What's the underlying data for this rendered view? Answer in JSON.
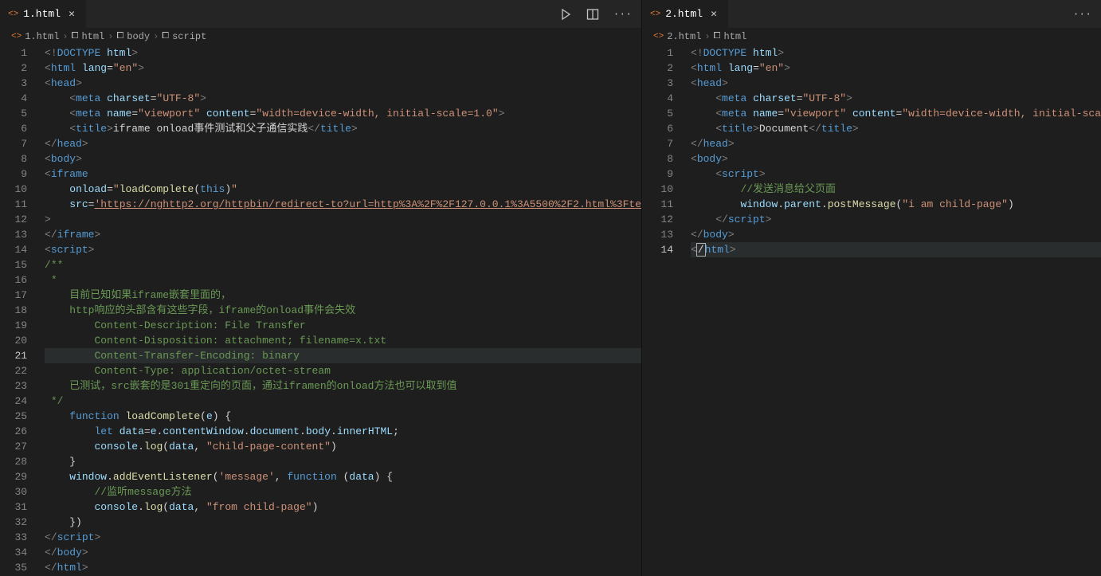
{
  "left": {
    "tab": {
      "filename": "1.html"
    },
    "breadcrumb": [
      "1.html",
      "html",
      "body",
      "script"
    ],
    "currentLine": 21,
    "lineCount": 35,
    "lines": [
      [
        {
          "c": "t-gray",
          "t": "<!"
        },
        {
          "c": "t-blue",
          "t": "DOCTYPE"
        },
        {
          "c": "t-white",
          "t": " "
        },
        {
          "c": "t-lblue",
          "t": "html"
        },
        {
          "c": "t-gray",
          "t": ">"
        }
      ],
      [
        {
          "c": "t-gray",
          "t": "<"
        },
        {
          "c": "t-blue",
          "t": "html"
        },
        {
          "c": "t-white",
          "t": " "
        },
        {
          "c": "t-lblue",
          "t": "lang"
        },
        {
          "c": "t-white",
          "t": "="
        },
        {
          "c": "t-str",
          "t": "\"en\""
        },
        {
          "c": "t-gray",
          "t": ">"
        }
      ],
      [
        {
          "c": "t-gray",
          "t": "<"
        },
        {
          "c": "t-blue",
          "t": "head"
        },
        {
          "c": "t-gray",
          "t": ">"
        }
      ],
      [
        {
          "c": "t-white",
          "t": "    "
        },
        {
          "c": "t-gray",
          "t": "<"
        },
        {
          "c": "t-blue",
          "t": "meta"
        },
        {
          "c": "t-white",
          "t": " "
        },
        {
          "c": "t-lblue",
          "t": "charset"
        },
        {
          "c": "t-white",
          "t": "="
        },
        {
          "c": "t-str",
          "t": "\"UTF-8\""
        },
        {
          "c": "t-gray",
          "t": ">"
        }
      ],
      [
        {
          "c": "t-white",
          "t": "    "
        },
        {
          "c": "t-gray",
          "t": "<"
        },
        {
          "c": "t-blue",
          "t": "meta"
        },
        {
          "c": "t-white",
          "t": " "
        },
        {
          "c": "t-lblue",
          "t": "name"
        },
        {
          "c": "t-white",
          "t": "="
        },
        {
          "c": "t-str",
          "t": "\"viewport\""
        },
        {
          "c": "t-white",
          "t": " "
        },
        {
          "c": "t-lblue",
          "t": "content"
        },
        {
          "c": "t-white",
          "t": "="
        },
        {
          "c": "t-str",
          "t": "\"width=device-width, initial-scale=1.0\""
        },
        {
          "c": "t-gray",
          "t": ">"
        }
      ],
      [
        {
          "c": "t-white",
          "t": "    "
        },
        {
          "c": "t-gray",
          "t": "<"
        },
        {
          "c": "t-blue",
          "t": "title"
        },
        {
          "c": "t-gray",
          "t": ">"
        },
        {
          "c": "t-white",
          "t": "iframe onload事件测试和父子通信实践"
        },
        {
          "c": "t-gray",
          "t": "</"
        },
        {
          "c": "t-blue",
          "t": "title"
        },
        {
          "c": "t-gray",
          "t": ">"
        }
      ],
      [
        {
          "c": "t-gray",
          "t": "</"
        },
        {
          "c": "t-blue",
          "t": "head"
        },
        {
          "c": "t-gray",
          "t": ">"
        }
      ],
      [
        {
          "c": "t-gray",
          "t": "<"
        },
        {
          "c": "t-blue",
          "t": "body"
        },
        {
          "c": "t-gray",
          "t": ">"
        }
      ],
      [
        {
          "c": "t-gray",
          "t": "<"
        },
        {
          "c": "t-blue",
          "t": "iframe"
        }
      ],
      [
        {
          "c": "t-white",
          "t": "    "
        },
        {
          "c": "t-lblue",
          "t": "onload"
        },
        {
          "c": "t-white",
          "t": "="
        },
        {
          "c": "t-str",
          "t": "\""
        },
        {
          "c": "t-yellow",
          "t": "loadComplete"
        },
        {
          "c": "t-white",
          "t": "("
        },
        {
          "c": "t-blue",
          "t": "this"
        },
        {
          "c": "t-white",
          "t": ")"
        },
        {
          "c": "t-str",
          "t": "\""
        }
      ],
      [
        {
          "c": "t-white",
          "t": "    "
        },
        {
          "c": "t-lblue",
          "t": "src"
        },
        {
          "c": "t-white",
          "t": "="
        },
        {
          "c": "t-str underline",
          "t": "'https://nghttp2.org/httpbin/redirect-to?url=http%3A%2F%2F127.0.0.1%3A5500%2F2.html%3Fte"
        }
      ],
      [
        {
          "c": "t-gray",
          "t": ">"
        }
      ],
      [
        {
          "c": "t-gray",
          "t": "</"
        },
        {
          "c": "t-blue",
          "t": "iframe"
        },
        {
          "c": "t-gray",
          "t": ">"
        }
      ],
      [
        {
          "c": "t-gray",
          "t": "<"
        },
        {
          "c": "t-blue",
          "t": "script"
        },
        {
          "c": "t-gray",
          "t": ">"
        }
      ],
      [
        {
          "c": "t-green",
          "t": "/**"
        }
      ],
      [
        {
          "c": "t-green",
          "t": " * "
        }
      ],
      [
        {
          "c": "t-green",
          "t": "    目前已知如果iframe嵌套里面的，"
        }
      ],
      [
        {
          "c": "t-green",
          "t": "    http响应的头部含有这些字段，iframe的onload事件会失效"
        }
      ],
      [
        {
          "c": "t-green",
          "t": "        Content-Description: File Transfer"
        }
      ],
      [
        {
          "c": "t-green",
          "t": "        Content-Disposition: attachment; filename=x.txt"
        }
      ],
      [
        {
          "c": "t-green",
          "t": "        Content-Transfer-Encoding: binary"
        }
      ],
      [
        {
          "c": "t-green",
          "t": "        Content-Type: application/octet-stream"
        }
      ],
      [
        {
          "c": "t-green",
          "t": "    已测试，src嵌套的是301重定向的页面，通过iframen的onload方法也可以取到值"
        }
      ],
      [
        {
          "c": "t-green",
          "t": " */"
        }
      ],
      [
        {
          "c": "t-white",
          "t": "    "
        },
        {
          "c": "t-blue",
          "t": "function"
        },
        {
          "c": "t-white",
          "t": " "
        },
        {
          "c": "t-yellow",
          "t": "loadComplete"
        },
        {
          "c": "t-white",
          "t": "("
        },
        {
          "c": "t-lblue",
          "t": "e"
        },
        {
          "c": "t-white",
          "t": ") {"
        }
      ],
      [
        {
          "c": "t-white",
          "t": "        "
        },
        {
          "c": "t-blue",
          "t": "let"
        },
        {
          "c": "t-white",
          "t": " "
        },
        {
          "c": "t-lblue",
          "t": "data"
        },
        {
          "c": "t-white",
          "t": "="
        },
        {
          "c": "t-lblue",
          "t": "e"
        },
        {
          "c": "t-white",
          "t": "."
        },
        {
          "c": "t-lblue",
          "t": "contentWindow"
        },
        {
          "c": "t-white",
          "t": "."
        },
        {
          "c": "t-lblue",
          "t": "document"
        },
        {
          "c": "t-white",
          "t": "."
        },
        {
          "c": "t-lblue",
          "t": "body"
        },
        {
          "c": "t-white",
          "t": "."
        },
        {
          "c": "t-lblue",
          "t": "innerHTML"
        },
        {
          "c": "t-white",
          "t": ";"
        }
      ],
      [
        {
          "c": "t-white",
          "t": "        "
        },
        {
          "c": "t-lblue",
          "t": "console"
        },
        {
          "c": "t-white",
          "t": "."
        },
        {
          "c": "t-yellow",
          "t": "log"
        },
        {
          "c": "t-white",
          "t": "("
        },
        {
          "c": "t-lblue",
          "t": "data"
        },
        {
          "c": "t-white",
          "t": ", "
        },
        {
          "c": "t-str",
          "t": "\"child-page-content\""
        },
        {
          "c": "t-white",
          "t": ")"
        }
      ],
      [
        {
          "c": "t-white",
          "t": "    }"
        }
      ],
      [
        {
          "c": "t-white",
          "t": "    "
        },
        {
          "c": "t-lblue",
          "t": "window"
        },
        {
          "c": "t-white",
          "t": "."
        },
        {
          "c": "t-yellow",
          "t": "addEventListener"
        },
        {
          "c": "t-white",
          "t": "("
        },
        {
          "c": "t-str",
          "t": "'message'"
        },
        {
          "c": "t-white",
          "t": ", "
        },
        {
          "c": "t-blue",
          "t": "function"
        },
        {
          "c": "t-white",
          "t": " ("
        },
        {
          "c": "t-lblue",
          "t": "data"
        },
        {
          "c": "t-white",
          "t": ") {"
        }
      ],
      [
        {
          "c": "t-white",
          "t": "        "
        },
        {
          "c": "t-green",
          "t": "//监听message方法"
        }
      ],
      [
        {
          "c": "t-white",
          "t": "        "
        },
        {
          "c": "t-lblue",
          "t": "console"
        },
        {
          "c": "t-white",
          "t": "."
        },
        {
          "c": "t-yellow",
          "t": "log"
        },
        {
          "c": "t-white",
          "t": "("
        },
        {
          "c": "t-lblue",
          "t": "data"
        },
        {
          "c": "t-white",
          "t": ", "
        },
        {
          "c": "t-str",
          "t": "\"from child-page\""
        },
        {
          "c": "t-white",
          "t": ")"
        }
      ],
      [
        {
          "c": "t-white",
          "t": "    })"
        }
      ],
      [
        {
          "c": "t-gray",
          "t": "</"
        },
        {
          "c": "t-blue",
          "t": "script"
        },
        {
          "c": "t-gray",
          "t": ">"
        }
      ],
      [
        {
          "c": "t-gray",
          "t": "</"
        },
        {
          "c": "t-blue",
          "t": "body"
        },
        {
          "c": "t-gray",
          "t": ">"
        }
      ],
      [
        {
          "c": "t-gray",
          "t": "</"
        },
        {
          "c": "t-blue",
          "t": "html"
        },
        {
          "c": "t-gray",
          "t": ">"
        }
      ]
    ]
  },
  "right": {
    "tab": {
      "filename": "2.html"
    },
    "breadcrumb": [
      "2.html",
      "html"
    ],
    "currentLine": 14,
    "lineCount": 14,
    "lines": [
      [
        {
          "c": "t-gray",
          "t": "<!"
        },
        {
          "c": "t-blue",
          "t": "DOCTYPE"
        },
        {
          "c": "t-white",
          "t": " "
        },
        {
          "c": "t-lblue",
          "t": "html"
        },
        {
          "c": "t-gray",
          "t": ">"
        }
      ],
      [
        {
          "c": "t-gray",
          "t": "<"
        },
        {
          "c": "t-blue",
          "t": "html"
        },
        {
          "c": "t-white",
          "t": " "
        },
        {
          "c": "t-lblue",
          "t": "lang"
        },
        {
          "c": "t-white",
          "t": "="
        },
        {
          "c": "t-str",
          "t": "\"en\""
        },
        {
          "c": "t-gray",
          "t": ">"
        }
      ],
      [
        {
          "c": "t-gray",
          "t": "<"
        },
        {
          "c": "t-blue",
          "t": "head"
        },
        {
          "c": "t-gray",
          "t": ">"
        }
      ],
      [
        {
          "c": "t-white",
          "t": "    "
        },
        {
          "c": "t-gray",
          "t": "<"
        },
        {
          "c": "t-blue",
          "t": "meta"
        },
        {
          "c": "t-white",
          "t": " "
        },
        {
          "c": "t-lblue",
          "t": "charset"
        },
        {
          "c": "t-white",
          "t": "="
        },
        {
          "c": "t-str",
          "t": "\"UTF-8\""
        },
        {
          "c": "t-gray",
          "t": ">"
        }
      ],
      [
        {
          "c": "t-white",
          "t": "    "
        },
        {
          "c": "t-gray",
          "t": "<"
        },
        {
          "c": "t-blue",
          "t": "meta"
        },
        {
          "c": "t-white",
          "t": " "
        },
        {
          "c": "t-lblue",
          "t": "name"
        },
        {
          "c": "t-white",
          "t": "="
        },
        {
          "c": "t-str",
          "t": "\"viewport\""
        },
        {
          "c": "t-white",
          "t": " "
        },
        {
          "c": "t-lblue",
          "t": "content"
        },
        {
          "c": "t-white",
          "t": "="
        },
        {
          "c": "t-str",
          "t": "\"width=device-width, initial-sca"
        }
      ],
      [
        {
          "c": "t-white",
          "t": "    "
        },
        {
          "c": "t-gray",
          "t": "<"
        },
        {
          "c": "t-blue",
          "t": "title"
        },
        {
          "c": "t-gray",
          "t": ">"
        },
        {
          "c": "t-white",
          "t": "Document"
        },
        {
          "c": "t-gray",
          "t": "</"
        },
        {
          "c": "t-blue",
          "t": "title"
        },
        {
          "c": "t-gray",
          "t": ">"
        }
      ],
      [
        {
          "c": "t-gray",
          "t": "</"
        },
        {
          "c": "t-blue",
          "t": "head"
        },
        {
          "c": "t-gray",
          "t": ">"
        }
      ],
      [
        {
          "c": "t-gray",
          "t": "<"
        },
        {
          "c": "t-blue",
          "t": "body"
        },
        {
          "c": "t-gray",
          "t": ">"
        }
      ],
      [
        {
          "c": "t-white",
          "t": "    "
        },
        {
          "c": "t-gray",
          "t": "<"
        },
        {
          "c": "t-blue",
          "t": "script"
        },
        {
          "c": "t-gray",
          "t": ">"
        }
      ],
      [
        {
          "c": "t-white",
          "t": "        "
        },
        {
          "c": "t-green",
          "t": "//发送消息给父页面"
        }
      ],
      [
        {
          "c": "t-white",
          "t": "        "
        },
        {
          "c": "t-lblue",
          "t": "window"
        },
        {
          "c": "t-white",
          "t": "."
        },
        {
          "c": "t-lblue",
          "t": "parent"
        },
        {
          "c": "t-white",
          "t": "."
        },
        {
          "c": "t-yellow",
          "t": "postMessage"
        },
        {
          "c": "t-white",
          "t": "("
        },
        {
          "c": "t-str",
          "t": "\"i am child-page\""
        },
        {
          "c": "t-white",
          "t": ")"
        }
      ],
      [
        {
          "c": "t-white",
          "t": "    "
        },
        {
          "c": "t-gray",
          "t": "</"
        },
        {
          "c": "t-blue",
          "t": "script"
        },
        {
          "c": "t-gray",
          "t": ">"
        }
      ],
      [
        {
          "c": "t-gray",
          "t": "</"
        },
        {
          "c": "t-blue",
          "t": "body"
        },
        {
          "c": "t-gray",
          "t": ">"
        }
      ],
      [
        {
          "c": "t-gray",
          "t": "<"
        },
        {
          "c": "t-cursor",
          "t": "/"
        },
        {
          "c": "t-blue",
          "t": "html"
        },
        {
          "c": "t-gray",
          "t": ">"
        }
      ]
    ]
  }
}
